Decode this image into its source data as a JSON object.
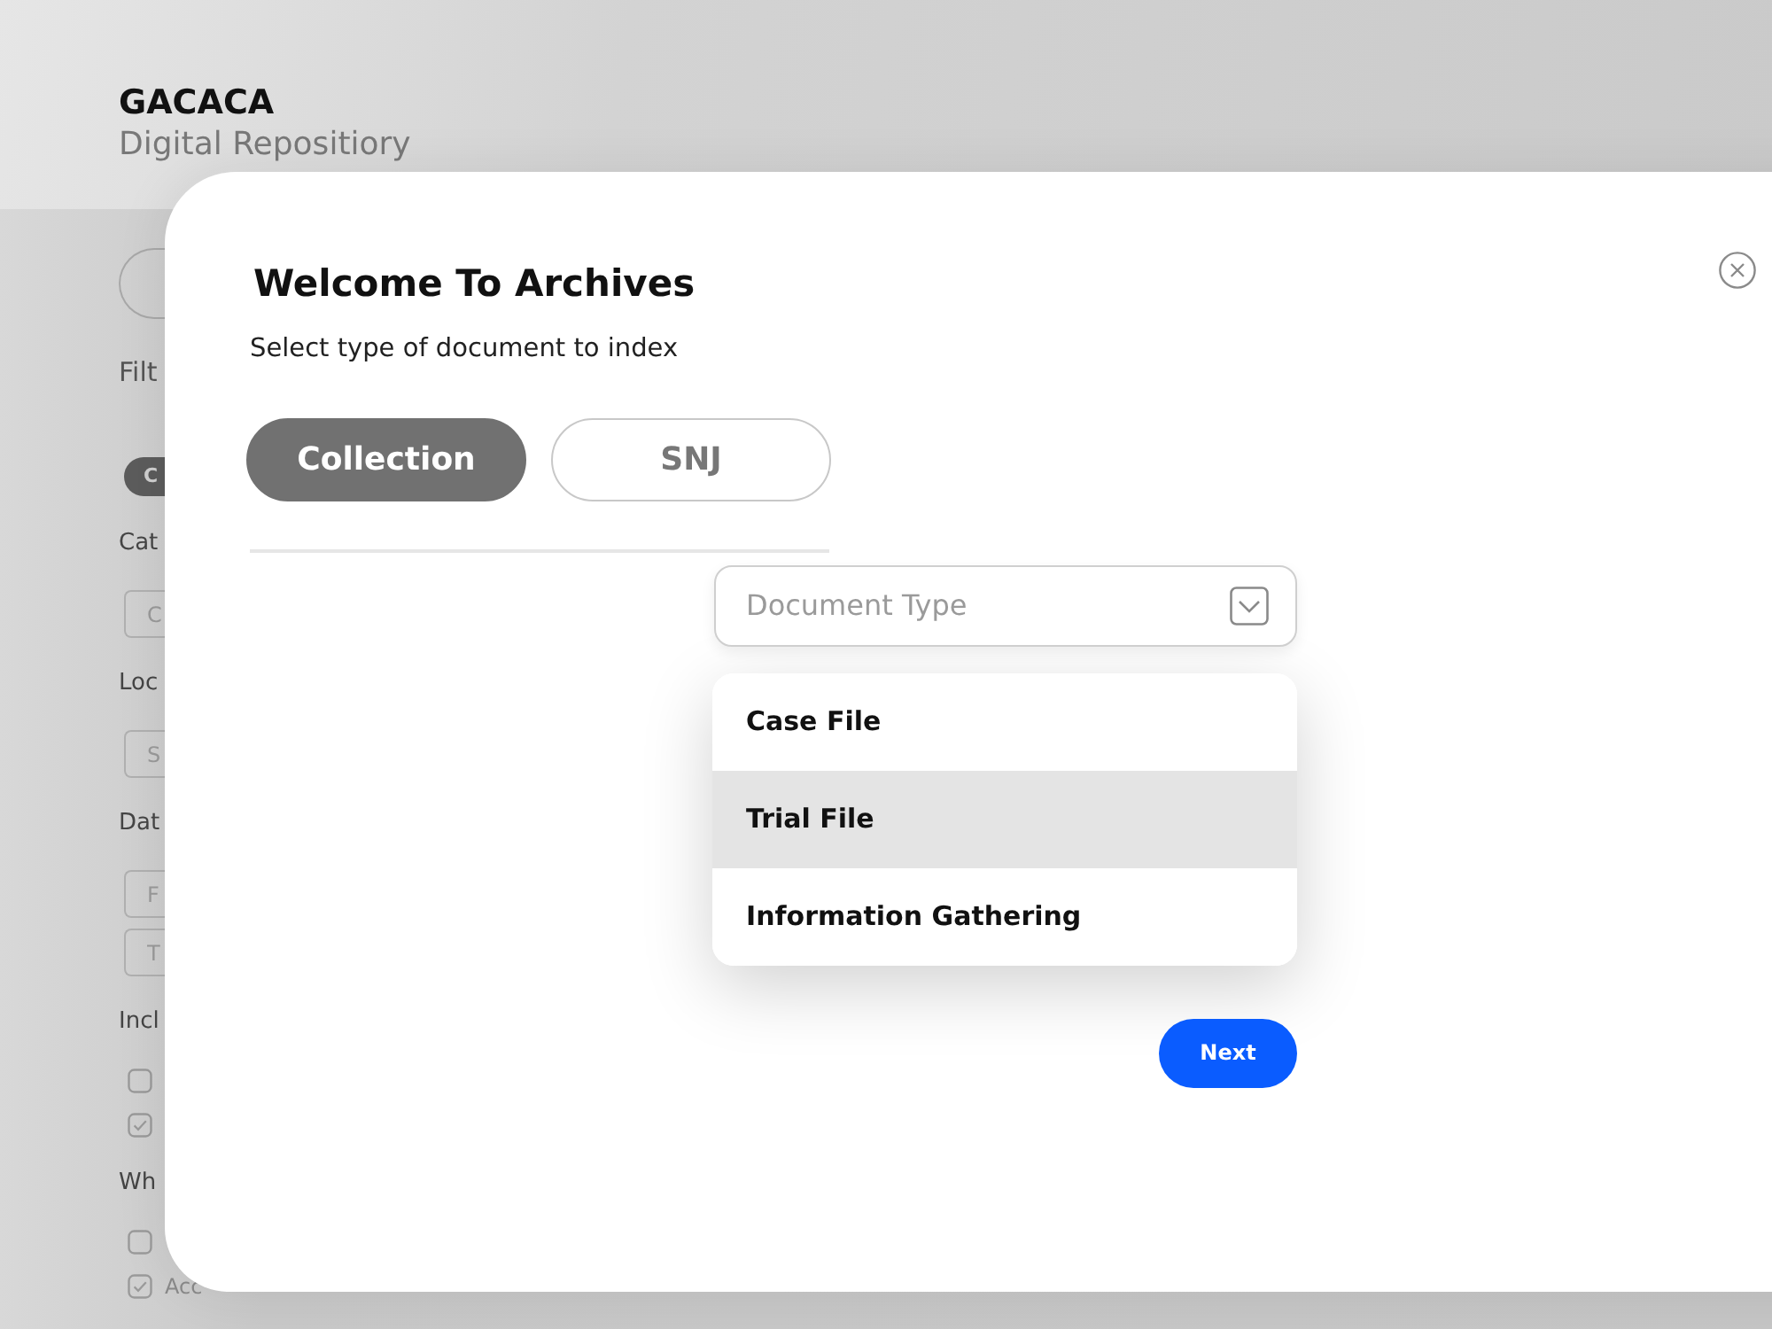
{
  "header": {
    "brand": "GACACA",
    "subtitle": "Digital Repositiory"
  },
  "sidebar": {
    "items": [
      {
        "kind": "pill"
      },
      {
        "kind": "heading",
        "text": "Filt"
      },
      {
        "kind": "chip",
        "text": "C"
      },
      {
        "kind": "label",
        "text": "Cat"
      },
      {
        "kind": "input",
        "placeholder": "C"
      },
      {
        "kind": "label",
        "text": "Loc"
      },
      {
        "kind": "input",
        "placeholder": "S"
      },
      {
        "kind": "label",
        "text": "Dat"
      },
      {
        "kind": "input",
        "placeholder": "F"
      },
      {
        "kind": "input",
        "placeholder": "T"
      },
      {
        "kind": "label",
        "text": "Incl"
      },
      {
        "kind": "checkbox",
        "checked": false
      },
      {
        "kind": "checkbox",
        "checked": true
      },
      {
        "kind": "label",
        "text": "Wh"
      },
      {
        "kind": "checkbox",
        "checked": false
      },
      {
        "kind": "checkbox",
        "checked": true,
        "label": "Acc"
      }
    ]
  },
  "modal": {
    "title": "Welcome To Archives",
    "subtitle": "Select type of document to index",
    "tabs": [
      {
        "label": "Collection",
        "selected": true
      },
      {
        "label": "SNJ",
        "selected": false
      }
    ],
    "dropdown": {
      "placeholder": "Document Type",
      "options": [
        {
          "label": "Case File",
          "selected": false
        },
        {
          "label": "Trial File",
          "selected": true
        },
        {
          "label": "Information Gathering",
          "selected": false
        }
      ]
    },
    "next_button": "Next"
  }
}
